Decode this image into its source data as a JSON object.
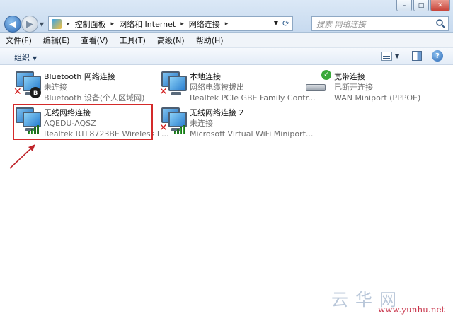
{
  "window": {
    "minimize_glyph": "–",
    "maximize_glyph": "□",
    "close_glyph": "✕"
  },
  "address_bar": {
    "breadcrumbs": [
      "控制面板",
      "网络和 Internet",
      "网络连接"
    ],
    "separator": "▸"
  },
  "search": {
    "placeholder": "搜索 网络连接"
  },
  "menu": [
    "文件(F)",
    "编辑(E)",
    "查看(V)",
    "工具(T)",
    "高级(N)",
    "帮助(H)"
  ],
  "command_bar": {
    "organize": "组织",
    "help": "?"
  },
  "connections": [
    {
      "name": "Bluetooth 网络连接",
      "status": "未连接",
      "device": "Bluetooth 设备(个人区域网)",
      "icon": "bluetooth-network-icon",
      "state": "disconnected"
    },
    {
      "name": "本地连接",
      "status": "网络电缆被拔出",
      "device": "Realtek PCIe GBE Family Contr...",
      "icon": "wired-network-icon",
      "state": "disconnected"
    },
    {
      "name": "宽带连接",
      "status": "已断开连接",
      "device": "WAN Miniport (PPPOE)",
      "icon": "broadband-modem-icon",
      "state": "disconnected"
    },
    {
      "name": "无线网络连接",
      "status": "AQEDU-AQSZ",
      "device": "Realtek RTL8723BE Wireless L...",
      "icon": "wireless-network-icon",
      "state": "connected"
    },
    {
      "name": "无线网络连接 2",
      "status": "未连接",
      "device": "Microsoft Virtual WiFi Miniport...",
      "icon": "wireless-network-icon",
      "state": "disconnected"
    }
  ],
  "colors": {
    "highlight_box": "#d42a2a",
    "annotation_arrow": "#c0242a",
    "signal_green": "#2fa52f",
    "disconnected_x": "#d21f1f"
  },
  "watermark": {
    "site": "www.yunhu.net"
  }
}
